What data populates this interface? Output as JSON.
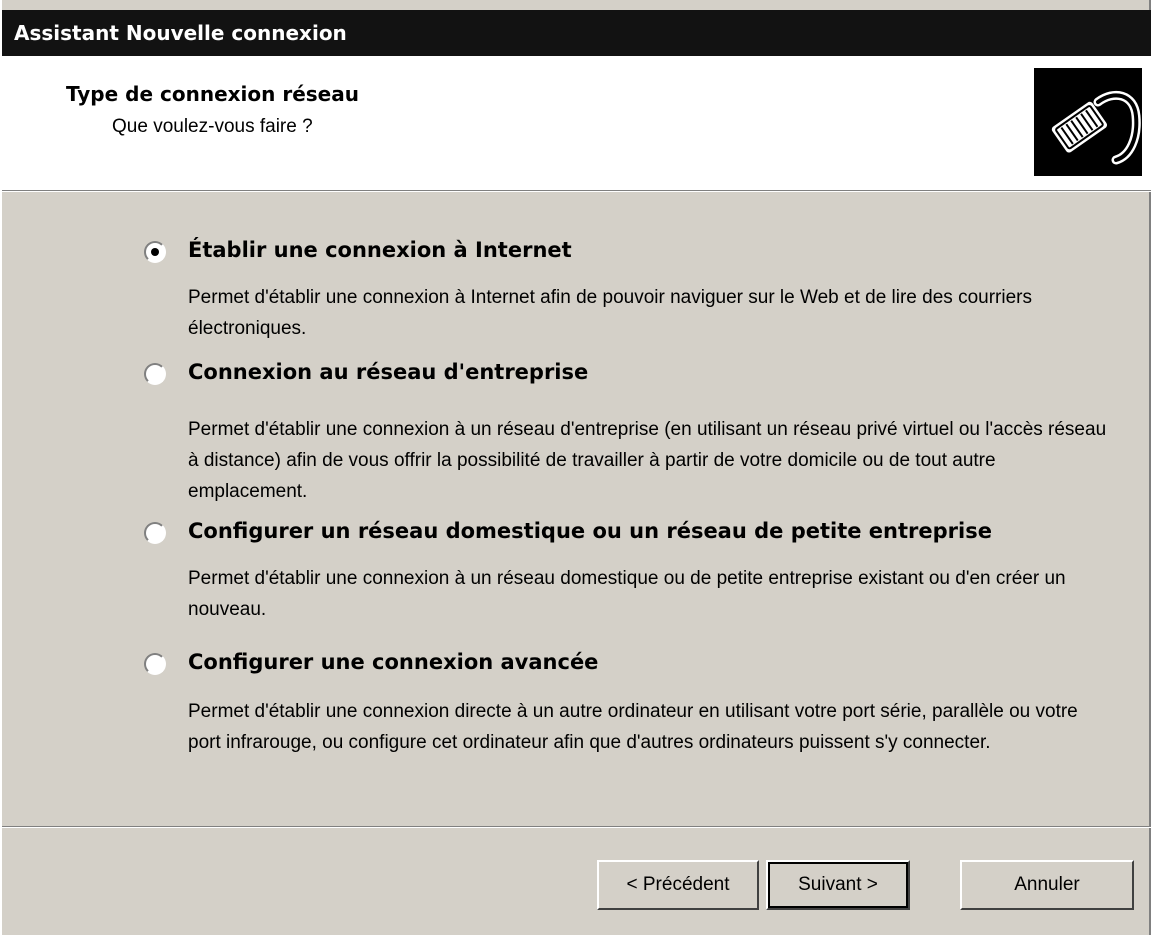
{
  "window": {
    "title": "Assistant Nouvelle connexion"
  },
  "header": {
    "title": "Type de connexion réseau",
    "subtitle": "Que voulez-vous faire ?",
    "icon": "network-cable-icon"
  },
  "options": [
    {
      "label": "Établir une connexion à Internet",
      "description": "Permet d'établir une connexion à Internet afin de pouvoir naviguer sur le Web et de lire des courriers électroniques.",
      "selected": true
    },
    {
      "label": "Connexion au réseau d'entreprise",
      "description": "Permet d'établir une connexion à un réseau d'entreprise (en utilisant un réseau privé virtuel ou l'accès réseau à distance) afin de vous offrir la possibilité de travailler à partir de votre domicile ou de tout autre emplacement.",
      "selected": false
    },
    {
      "label": "Configurer un réseau domestique ou un réseau de petite entreprise",
      "description": "Permet d'établir une connexion à un réseau domestique ou de petite entreprise existant ou d'en créer un nouveau.",
      "selected": false
    },
    {
      "label": "Configurer une connexion avancée",
      "description": "Permet d'établir une connexion directe à un autre ordinateur en utilisant votre port série, parallèle ou votre port infrarouge, ou configure cet ordinateur afin que d'autres ordinateurs puissent s'y connecter.",
      "selected": false
    }
  ],
  "buttons": {
    "back": "< Précédent",
    "next": "Suivant >",
    "cancel": "Annuler"
  }
}
